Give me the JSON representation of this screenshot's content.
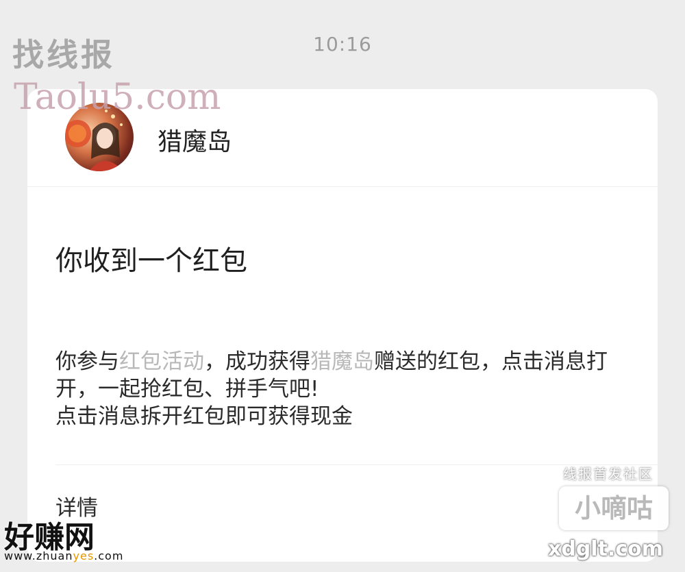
{
  "status": {
    "time": "10:16"
  },
  "message": {
    "sender_name": "猎魔岛",
    "avatar_icon": "avatar-girl-with-lantern",
    "title": "你收到一个红包",
    "body": {
      "part1": "你参与",
      "link1": "红包活动",
      "part2": "，成功获得",
      "link2": "猎魔岛",
      "part3": "赠送的红包，点击消息打开，一起抢红包、拼手气吧!",
      "line2": "点击消息拆开红包即可获得现金"
    },
    "details_label": "详情"
  },
  "watermarks": {
    "top_left_cn": "找线报",
    "top_left_en": "Taolu5.com",
    "bottom_right_small": "线报首发社区",
    "bottom_right_brand": "小嘀咕",
    "bottom_right_url": "xdglt.com",
    "bottom_left_brand": "好赚网",
    "bottom_left_url_a": "www.zhuan",
    "bottom_left_url_b": "yes",
    "bottom_left_url_c": ".com"
  },
  "colors": {
    "background": "#ededed",
    "card": "#ffffff",
    "link_text": "#b8b8b8"
  }
}
